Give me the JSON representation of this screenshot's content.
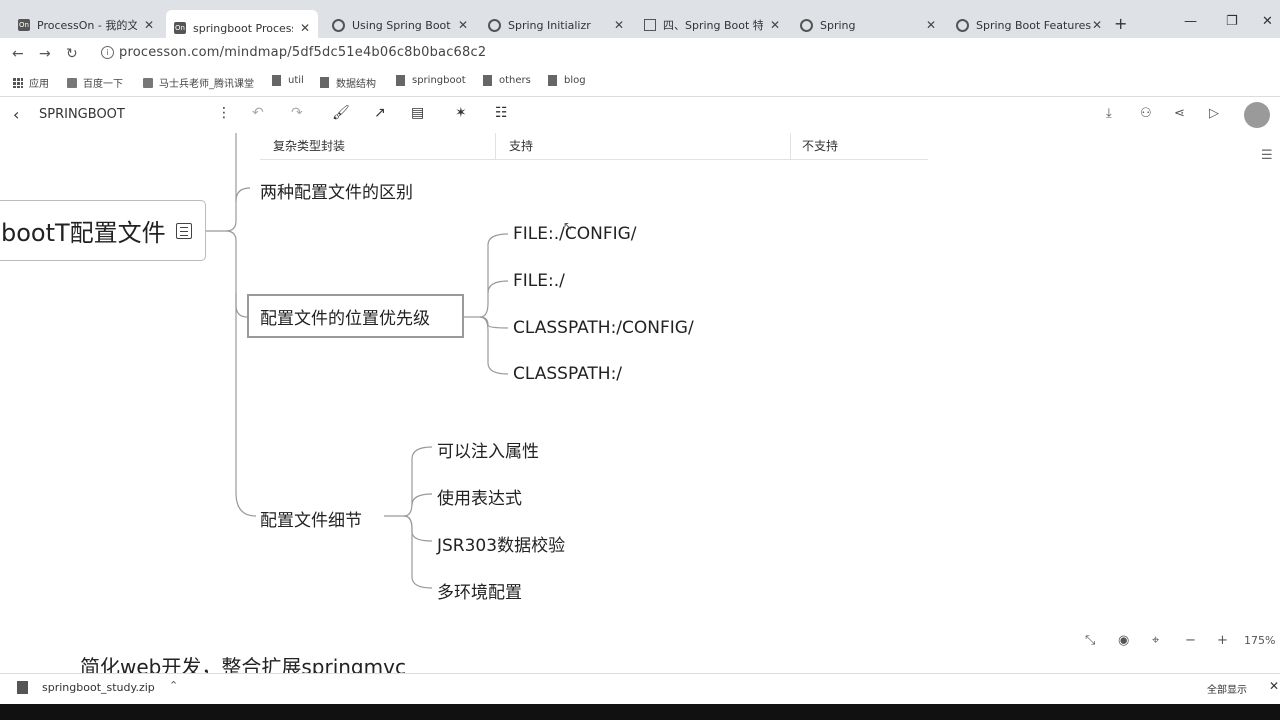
{
  "browser": {
    "tabs": [
      {
        "title": "ProcessOn - 我的文件",
        "icon": "processon-icon"
      },
      {
        "title": "springboot ProcessOn",
        "icon": "processon-icon"
      },
      {
        "title": "Using Spring Boot",
        "icon": "spring-icon"
      },
      {
        "title": "Spring Initializr",
        "icon": "spring-icon"
      },
      {
        "title": "四、Spring Boot 特性",
        "icon": "book-icon"
      },
      {
        "title": "Spring",
        "icon": "spring-icon"
      },
      {
        "title": "Spring Boot Features",
        "icon": "spring-icon"
      }
    ],
    "url": "processon.com/mindmap/5df5dc51e4b06c8b0bac68c2",
    "bookmarks": [
      {
        "label": "应用",
        "icon": "apps-icon"
      },
      {
        "label": "百度一下",
        "icon": "page-icon"
      },
      {
        "label": "马士兵老师_腾讯课堂",
        "icon": "page-icon"
      },
      {
        "label": "util",
        "icon": "folder-icon"
      },
      {
        "label": "数据结构",
        "icon": "folder-icon"
      },
      {
        "label": "springboot",
        "icon": "folder-icon"
      },
      {
        "label": "others",
        "icon": "folder-icon"
      },
      {
        "label": "blog",
        "icon": "folder-icon"
      }
    ]
  },
  "app": {
    "document_title": "SPRINGBOOT",
    "zoom": "175%"
  },
  "mindmap": {
    "table": {
      "cells": [
        "复杂类型封装",
        "支持",
        "不支持"
      ]
    },
    "root": "bootT配置文件",
    "branches": {
      "difference": "两种配置文件的区别",
      "priority": {
        "label": "配置文件的位置优先级",
        "children": [
          "FILE:./CONFIG/",
          "FILE:./",
          "CLASSPATH:/CONFIG/",
          "CLASSPATH:/"
        ]
      },
      "details": {
        "label": "配置文件细节",
        "children": [
          "可以注入属性",
          "使用表达式",
          "JSR303数据校验",
          "多环境配置"
        ]
      }
    },
    "partial_bottom": "简化web开发，整合扩展springmvc"
  },
  "downloads": {
    "file": "springboot_study.zip",
    "show_all": "全部显示"
  }
}
